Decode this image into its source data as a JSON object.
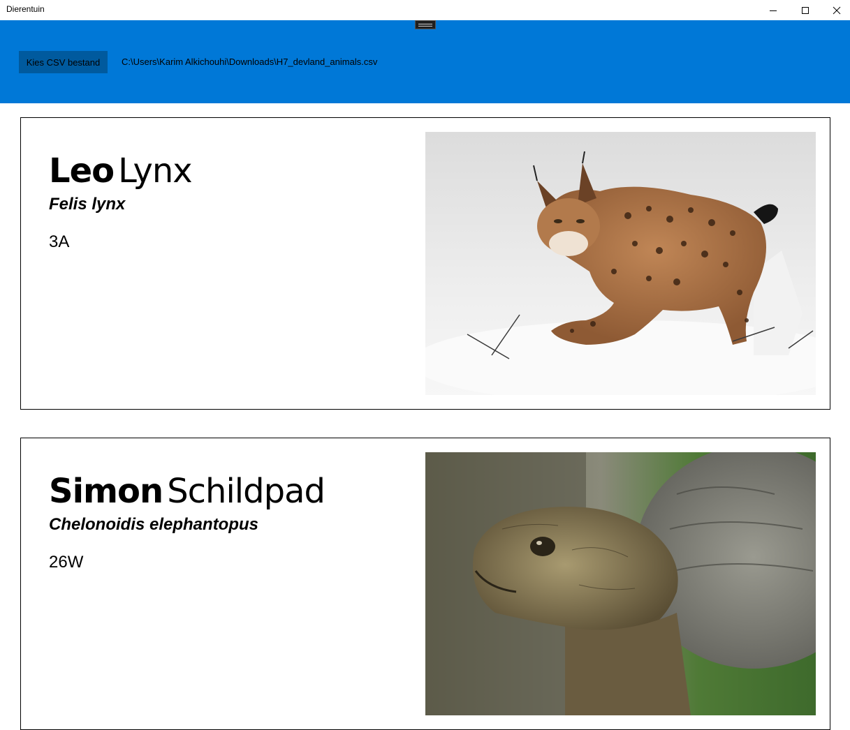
{
  "window": {
    "title": "Dierentuin"
  },
  "toolbar": {
    "choose_csv_label": "Kies CSV bestand",
    "csv_path": "C:\\Users\\Karim Alkichouhi\\Downloads\\H7_devland_animals.csv"
  },
  "animals": [
    {
      "first_name": "Leo",
      "last_name": "Lynx",
      "species": "Felis lynx",
      "code": "3A",
      "image": "lynx-photo"
    },
    {
      "first_name": "Simon",
      "last_name": "Schildpad",
      "species": "Chelonoidis elephantopus",
      "code": "26W",
      "image": "tortoise-photo"
    }
  ],
  "colors": {
    "accent": "#0078d7",
    "button": "#005a9e"
  }
}
